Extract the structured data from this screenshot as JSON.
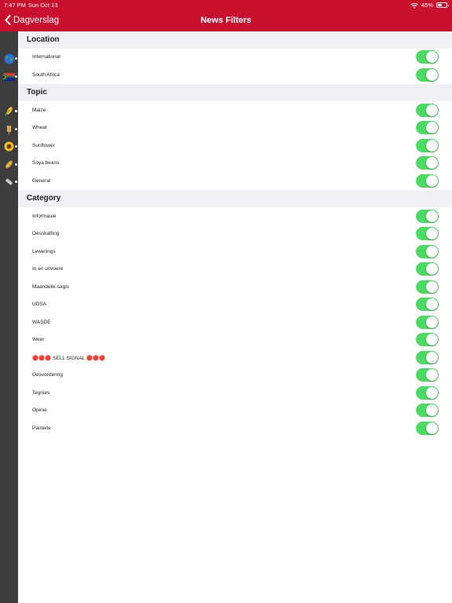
{
  "status_bar": {
    "time": "7:47 PM",
    "date": "Sun Oct 13",
    "battery": "45%"
  },
  "nav": {
    "back_label": "Dagverslag",
    "title": "News Filters"
  },
  "colors": {
    "brand": "#c8102e",
    "toggle_on": "#4cd964",
    "section_bg": "#efeff4"
  },
  "side_icons": [
    "globe-icon",
    "south-africa-flag-icon",
    "maize-icon",
    "wheat-icon",
    "sunflower-icon",
    "soya-beans-icon",
    "general-icon"
  ],
  "sections": [
    {
      "title": "Location",
      "items": [
        {
          "label": "International",
          "on": true
        },
        {
          "label": "South Africa",
          "on": true
        }
      ]
    },
    {
      "title": "Topic",
      "items": [
        {
          "label": "Maize",
          "on": true
        },
        {
          "label": "Wheat",
          "on": true
        },
        {
          "label": "Sunflower",
          "on": true
        },
        {
          "label": "Soya beans",
          "on": true
        },
        {
          "label": "General",
          "on": true
        }
      ]
    },
    {
      "title": "Category",
      "items": [
        {
          "label": "Informasie",
          "on": true
        },
        {
          "label": "Oesskatting",
          "on": true
        },
        {
          "label": "Lewerings",
          "on": true
        },
        {
          "label": "In en uitvoere",
          "on": true
        },
        {
          "label": "Maandelik-sagis",
          "on": true
        },
        {
          "label": "UDSA",
          "on": true
        },
        {
          "label": "WASDE",
          "on": true
        },
        {
          "label": "Weer",
          "on": true
        },
        {
          "label": "🔴🔴🔴 SELL SIGNAL 🔴🔴🔴",
          "on": true
        },
        {
          "label": "Oesvordering",
          "on": true
        },
        {
          "label": "Tegnies",
          "on": true
        },
        {
          "label": "Opinie",
          "on": true
        },
        {
          "label": "Pariteite",
          "on": true
        }
      ]
    }
  ]
}
